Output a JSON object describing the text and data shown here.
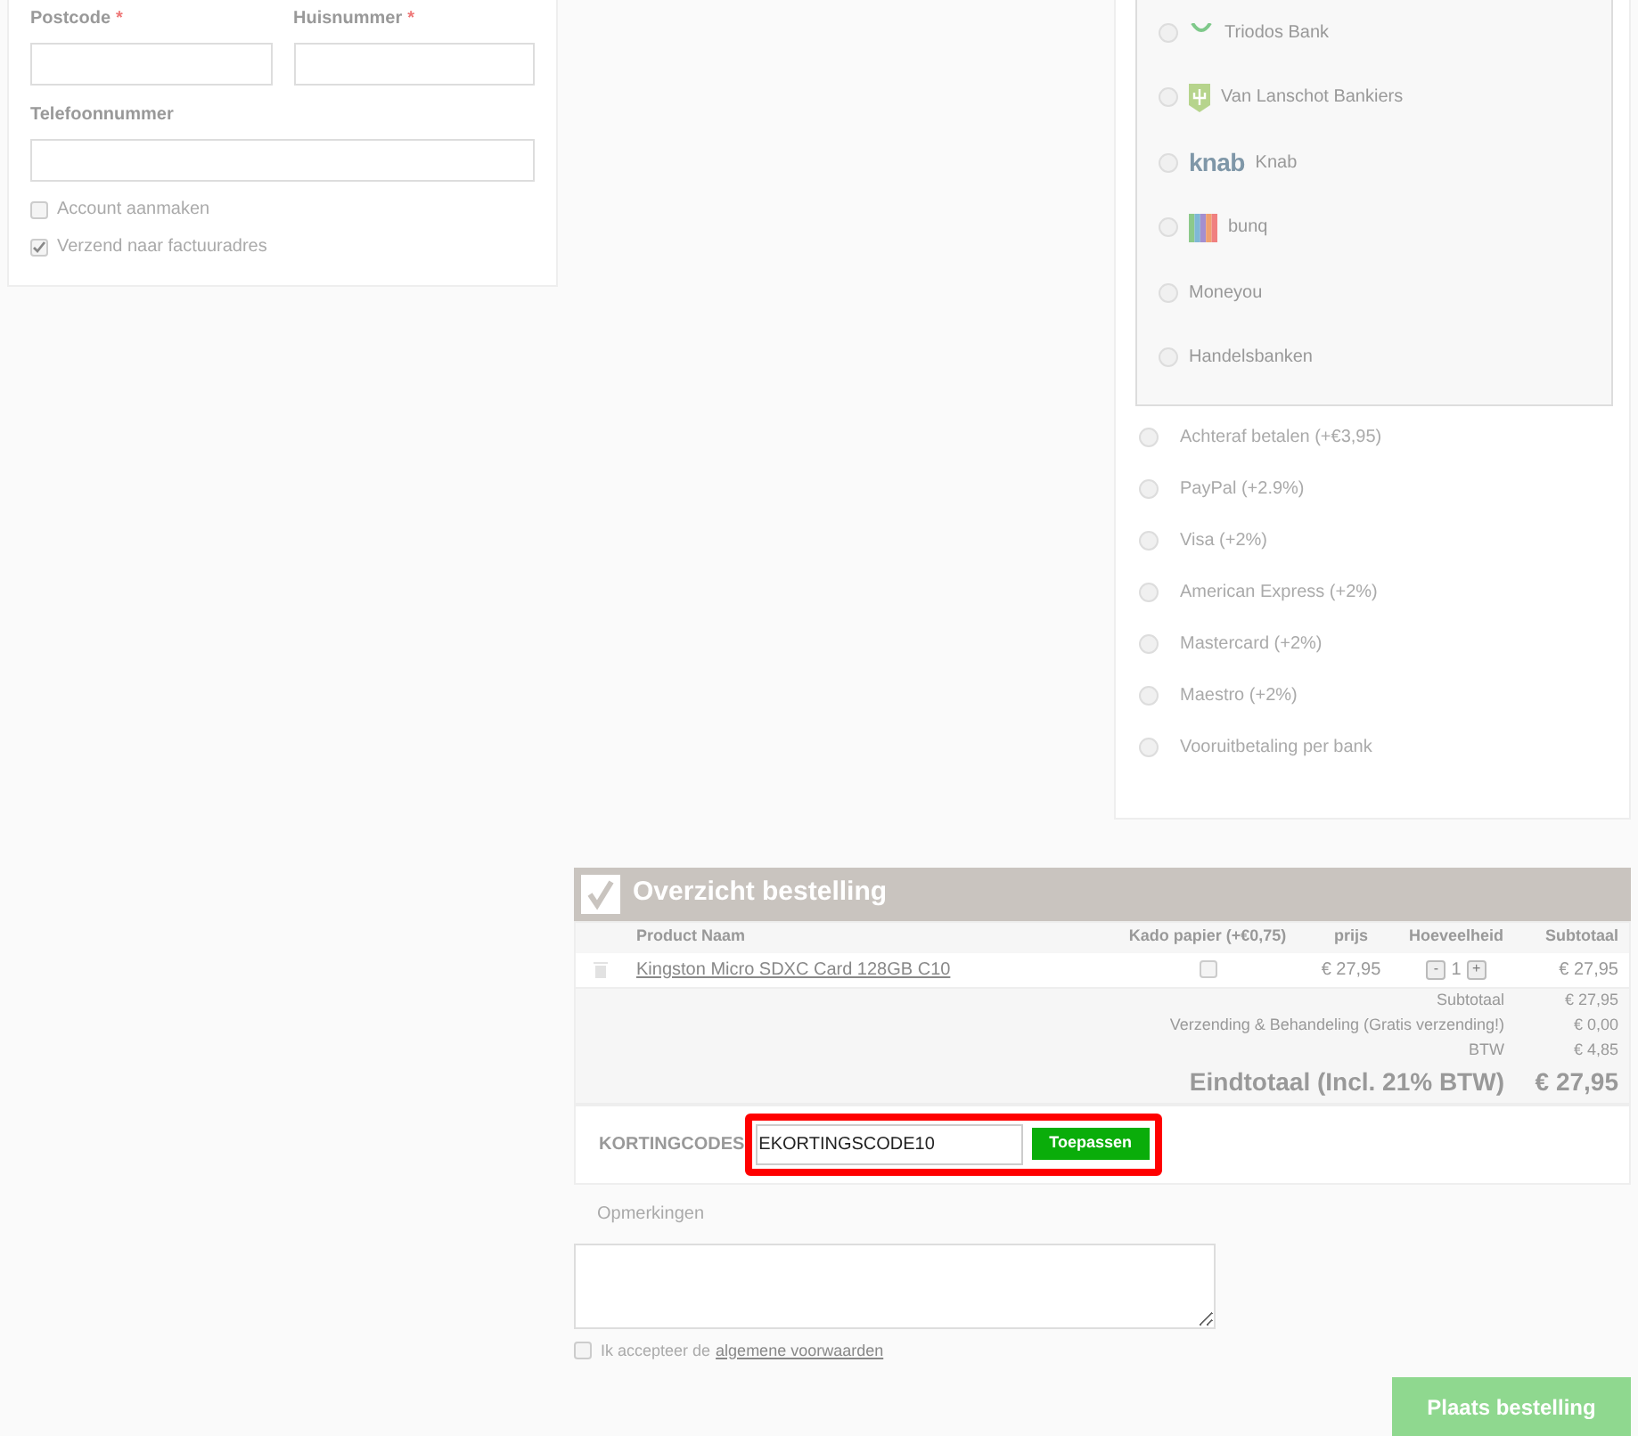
{
  "address_form": {
    "fields": [
      {
        "label": "Postcode",
        "required": true
      },
      {
        "label": "Huisnummer",
        "required": true
      },
      {
        "label": "Telefoonnummer",
        "required": false
      }
    ],
    "required_mark": "*",
    "options": [
      {
        "label": "Account aanmaken",
        "checked": false
      },
      {
        "label": "Verzend naar factuuradres",
        "checked": true
      }
    ]
  },
  "banks": [
    {
      "name": "Triodos Bank",
      "kind": "leaf",
      "selected": false
    },
    {
      "name": "Van Lanschot Bankiers",
      "kind": "shield",
      "selected": false
    },
    {
      "name": "Knab",
      "kind": "wordmark",
      "logo_text": "knab",
      "selected": false
    },
    {
      "name": "bunq",
      "kind": "stripes",
      "selected": false
    },
    {
      "name": "Moneyou",
      "kind": "plain",
      "selected": false
    },
    {
      "name": "Handelsbanken",
      "kind": "plain",
      "selected": false
    }
  ],
  "payment_methods": [
    {
      "label": "Achteraf betalen (+€3,95)",
      "selected": false
    },
    {
      "label": "PayPal (+2.9%)",
      "selected": false
    },
    {
      "label": "Visa (+2%)",
      "selected": false
    },
    {
      "label": "American Express (+2%)",
      "selected": false
    },
    {
      "label": "Mastercard (+2%)",
      "selected": false
    },
    {
      "label": "Maestro (+2%)",
      "selected": false
    },
    {
      "label": "Vooruitbetaling per bank",
      "selected": false
    }
  ],
  "order": {
    "title": "Overzicht bestelling",
    "columns": [
      "Product Naam",
      "Kado papier (+€0,75)",
      "prijs",
      "Hoeveelheid",
      "Subtotaal"
    ],
    "rows": [
      {
        "product": "Kingston Micro SDXC Card 128GB C10",
        "gift_wrap": false,
        "price": "€ 27,95",
        "minus": "-",
        "quantity": "1",
        "plus": "+",
        "subtotal": "€ 27,95"
      }
    ],
    "totals": [
      {
        "label": "Subtotaal",
        "value": "€ 27,95",
        "kind": "line"
      },
      {
        "label": "Verzending & Behandeling (Gratis verzending!)",
        "value": "€ 0,00",
        "kind": "line"
      },
      {
        "label": "BTW",
        "value": "€ 4,85",
        "kind": "line"
      },
      {
        "label": "Eindtotaal (Incl. 21% BTW)",
        "value": "€ 27,95",
        "kind": "grand"
      }
    ]
  },
  "discount": {
    "label": "KORTINGCODES",
    "value": "EKORTINGSCODE10",
    "button": "Toepassen",
    "highlighted": true
  },
  "remarks": {
    "label": "Opmerkingen"
  },
  "terms": {
    "checked": false,
    "text": "Ik accepteer de",
    "link": "algemene voorwaarden"
  },
  "submit": {
    "label": "Plaats bestelling"
  }
}
